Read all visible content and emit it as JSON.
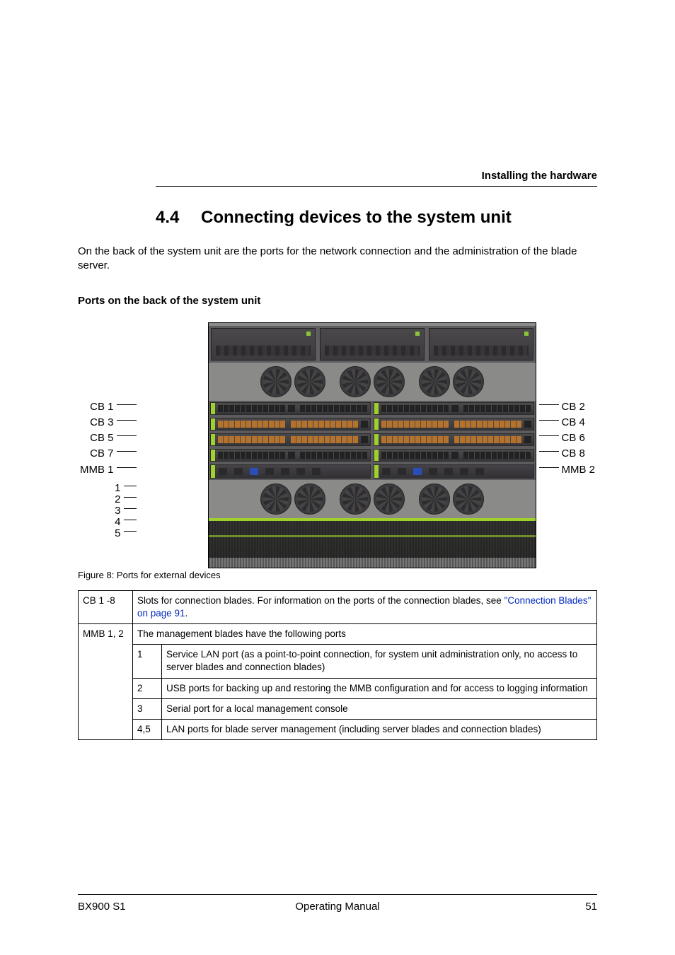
{
  "header": {
    "running": "Installing the hardware"
  },
  "section": {
    "number": "4.4",
    "title": "Connecting devices to the system unit",
    "intro": "On the back of the system unit are the ports for the network connection and the administration of the blade server.",
    "subhead": "Ports on the back of the system unit"
  },
  "figure": {
    "caption": "Figure 8: Ports for external devices",
    "left_labels": [
      "CB 1",
      "CB 3",
      "CB 5",
      "CB 7",
      "MMB 1"
    ],
    "right_labels": [
      "CB 2",
      "CB 4",
      "CB 6",
      "CB 8",
      "MMB 2"
    ],
    "left_numbers": [
      "1",
      "2",
      "3",
      "4",
      "5"
    ]
  },
  "table": {
    "row1_key": "CB 1 -8",
    "row1_text_a": "Slots for connection blades. For information on the ports of the connection blades, see ",
    "row1_link": "\"Connection Blades\" on page 91",
    "row1_text_b": ".",
    "row2_key": "MMB 1, 2",
    "row2_text": "The management blades have the following ports",
    "sub": [
      {
        "k": "1",
        "v": "Service LAN port (as a point-to-point connection, for system unit administration only, no access to server blades and connection blades)"
      },
      {
        "k": "2",
        "v": "USB ports for backing up and restoring the MMB configuration and for access to logging information"
      },
      {
        "k": "3",
        "v": "Serial port for a local management console"
      },
      {
        "k": "4,5",
        "v": "LAN ports for blade server management (including server blades and connection blades)"
      }
    ]
  },
  "footer": {
    "left": "BX900 S1",
    "center": "Operating Manual",
    "page": "51"
  }
}
